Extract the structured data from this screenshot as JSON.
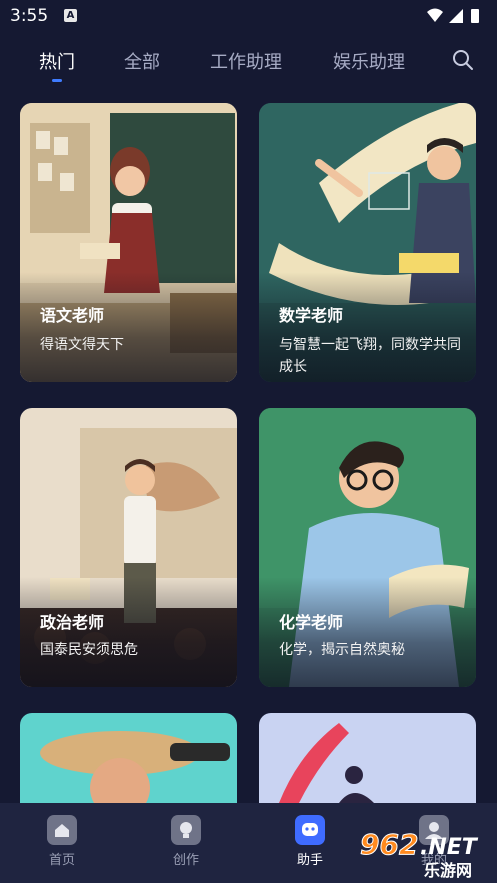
{
  "status_bar": {
    "time": "3:55",
    "notification_badge": "A"
  },
  "tabs": [
    {
      "label": "热门",
      "active": true
    },
    {
      "label": "全部",
      "active": false
    },
    {
      "label": "工作助理",
      "active": false
    },
    {
      "label": "娱乐助理",
      "active": false
    }
  ],
  "search_icon": "search-icon",
  "cards": [
    {
      "title": "语文老师",
      "desc": "得语文得天下"
    },
    {
      "title": "数学老师",
      "desc": "与智慧一起飞翔，同数学共同成长"
    },
    {
      "title": "政治老师",
      "desc": "国泰民安须思危"
    },
    {
      "title": "化学老师",
      "desc": "化学，揭示自然奥秘"
    }
  ],
  "bottom_nav": [
    {
      "label": "首页",
      "icon": "home-icon",
      "active": false
    },
    {
      "label": "创作",
      "icon": "bulb-icon",
      "active": false
    },
    {
      "label": "助手",
      "icon": "assistant-icon",
      "active": true
    },
    {
      "label": "我的",
      "icon": "profile-icon",
      "active": false
    }
  ],
  "watermark": {
    "brand": "962.NET",
    "subtitle": "乐游网"
  },
  "colors": {
    "background": "#151932",
    "accent": "#3f7cff",
    "nav_bg": "#1f2440"
  }
}
